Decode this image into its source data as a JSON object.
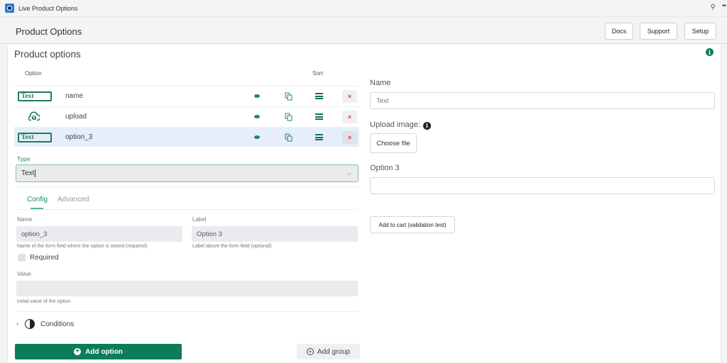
{
  "window": {
    "app_title": "Live Product Options",
    "icons": [
      "app-logo-icon",
      "pin-icon",
      "more-icon"
    ]
  },
  "header": {
    "title": "Product Options",
    "buttons": [
      {
        "label": "Docs"
      },
      {
        "label": "Support"
      },
      {
        "label": "Setup"
      }
    ]
  },
  "editor": {
    "title": "Product options",
    "columns": {
      "option": "Option",
      "sort": "Sort"
    },
    "options": [
      {
        "type_badge": "Text",
        "type_icon": "text-badge-icon",
        "name": "name",
        "selected": false
      },
      {
        "type_badge": "",
        "type_icon": "upload-icon",
        "name": "upload",
        "selected": false
      },
      {
        "type_badge": "Text",
        "type_icon": "text-badge-icon",
        "name": "option_3",
        "selected": true
      }
    ],
    "row_actions": {
      "delete_glyph": "×"
    },
    "type": {
      "label": "Type",
      "value": "Text",
      "chevron": "⌵"
    },
    "tabs": [
      {
        "label": "Config",
        "active": true
      },
      {
        "label": "Advanced",
        "active": false
      }
    ],
    "config": {
      "name_label": "Name",
      "name_value": "option_3",
      "name_help": "Name of the form field where the option is stored (required)",
      "label_label": "Label",
      "label_value": "Option 3",
      "label_help": "Label above the form field (optional)",
      "required_label": "Required",
      "required_checked": false,
      "value_label": "Value",
      "value_value": "",
      "value_help": "Initial value of the option"
    },
    "conditions": {
      "label": "Conditions",
      "chevron": "›"
    },
    "add_option_label": "Add option",
    "add_group_label": "Add group"
  },
  "preview": {
    "name_label": "Name",
    "name_placeholder": "Text",
    "upload_label": "Upload image:",
    "choose_file_label": "Choose file",
    "option3_label": "Option 3",
    "option3_value": "",
    "add_to_cart_label": "Add to cart (validation test)"
  },
  "colors": {
    "primary": "#0d7c5a",
    "accent_text": "#1d8a63",
    "delete": "#e0343a",
    "selected_row": "#e6eefa"
  }
}
